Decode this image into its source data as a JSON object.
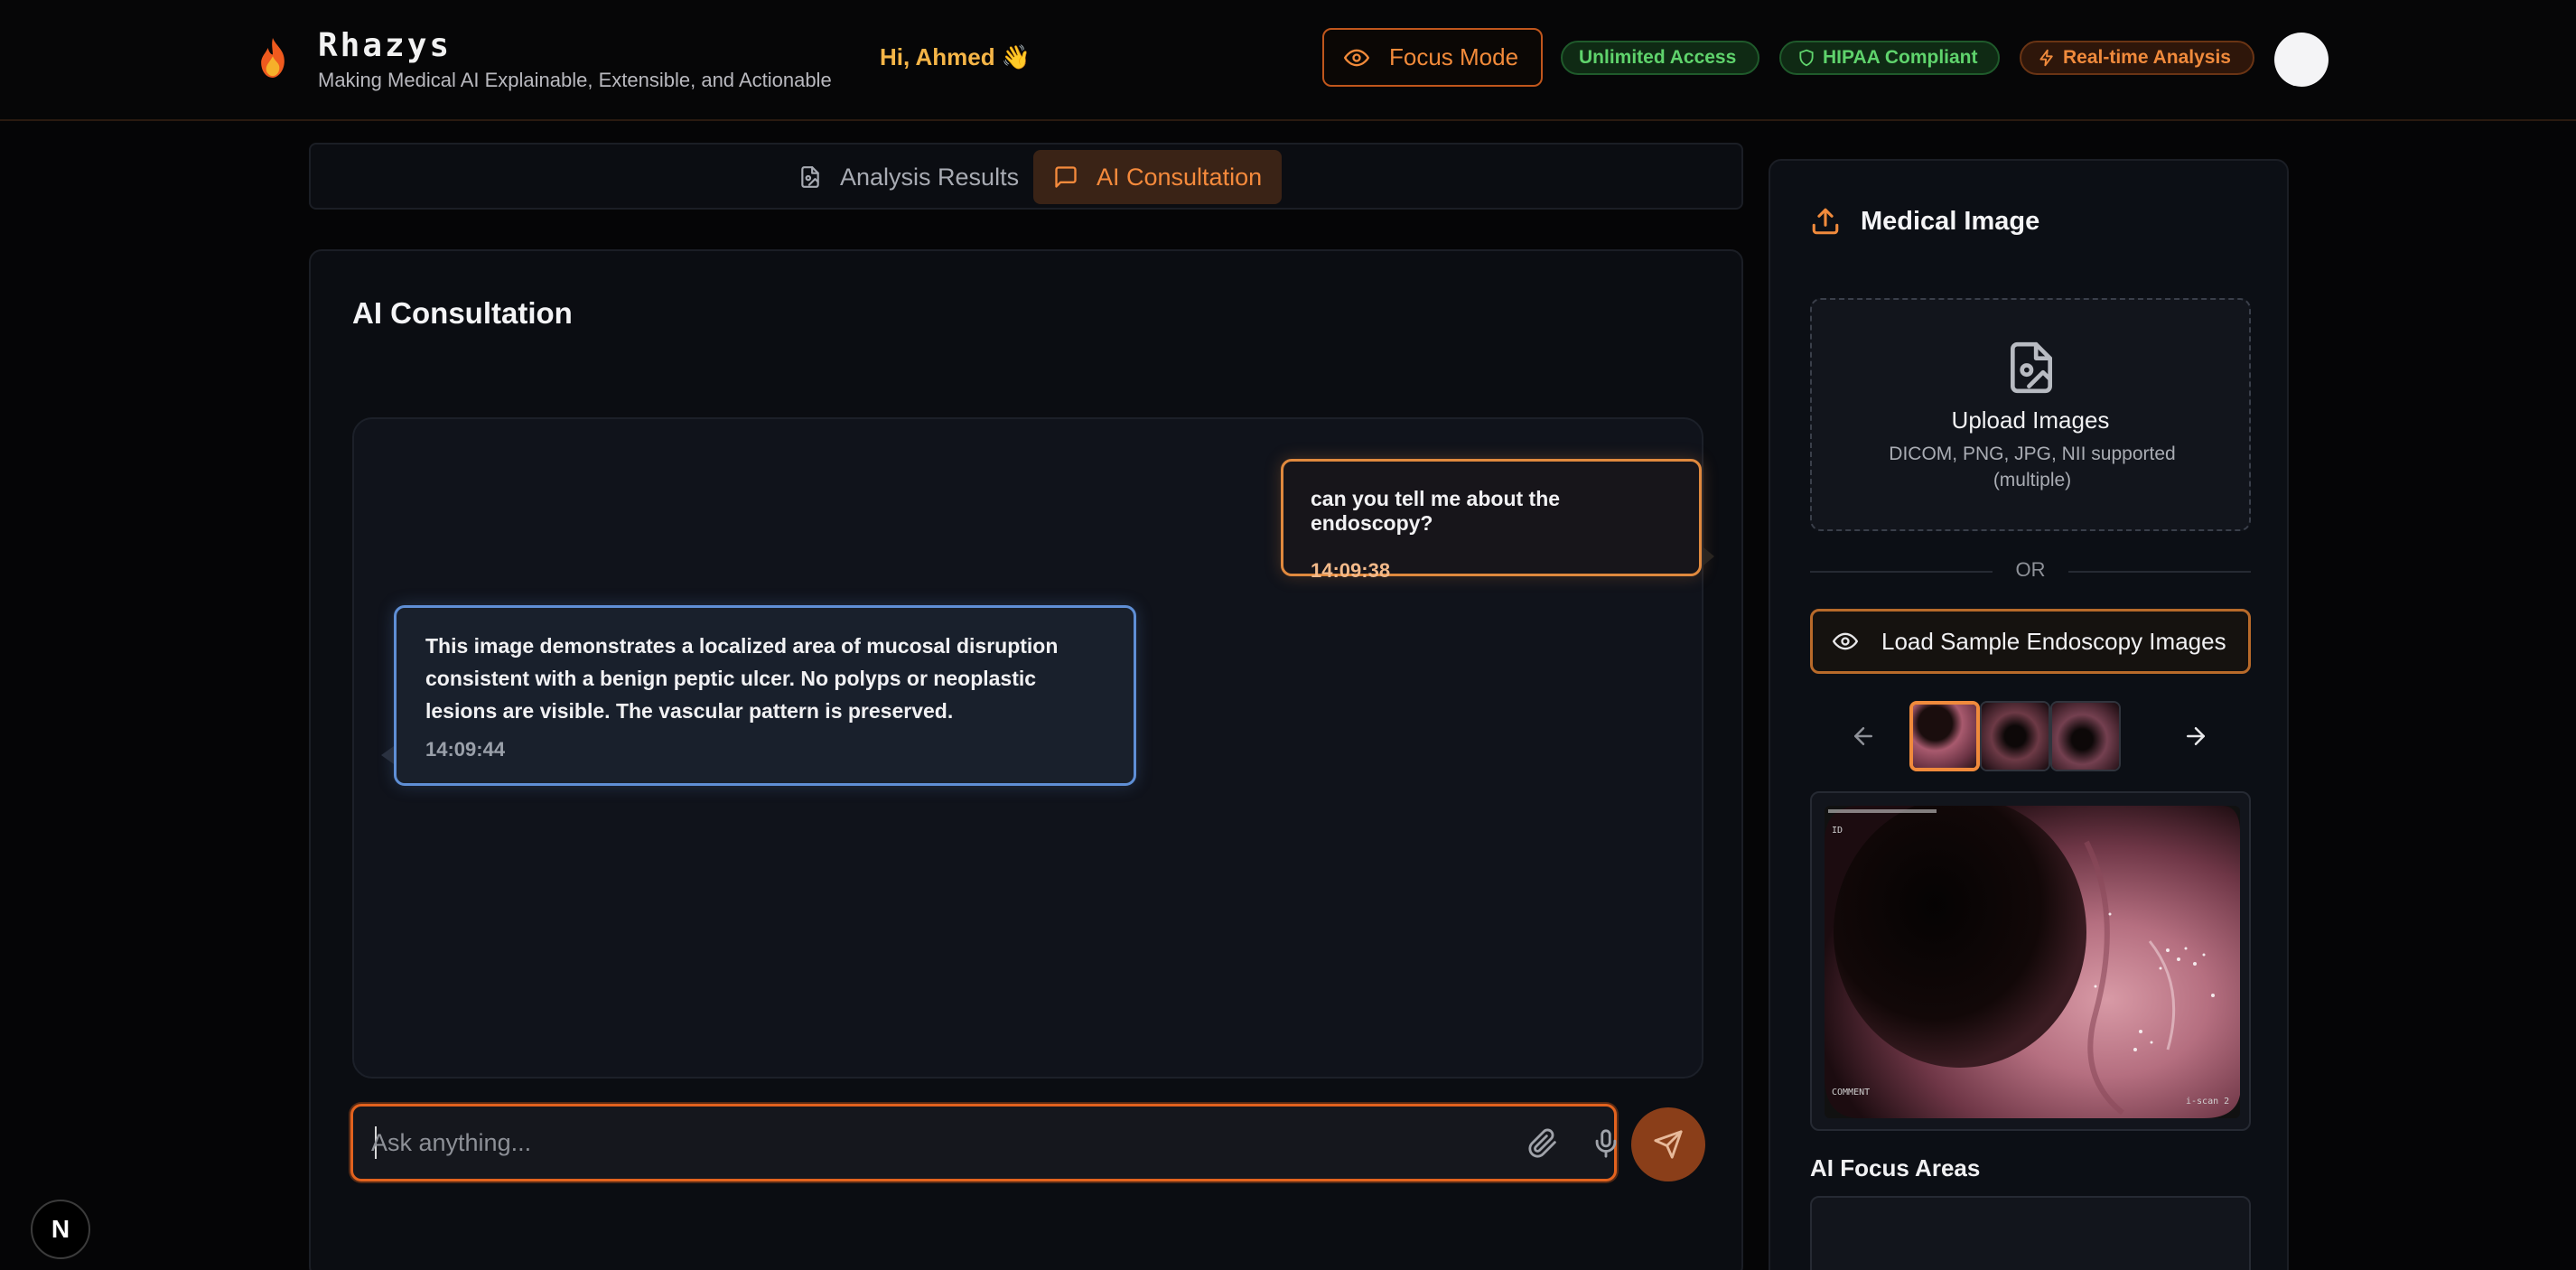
{
  "header": {
    "brand": "Rhazys",
    "tagline": "Making Medical AI Explainable, Extensible, and Actionable",
    "greeting": "Hi, Ahmed 👋",
    "focus_mode_label": "Focus Mode",
    "badges": [
      {
        "label": "Unlimited Access"
      },
      {
        "label": "HIPAA Compliant"
      },
      {
        "label": "Real-time Analysis"
      }
    ]
  },
  "tabs": {
    "analysis_label": "Analysis Results",
    "ai_label": "AI Consultation",
    "active": "AI Consultation"
  },
  "consultation": {
    "title": "AI Consultation",
    "messages": [
      {
        "role": "user",
        "text": "can you tell me about the endoscopy?",
        "time": "14:09:38"
      },
      {
        "role": "assistant",
        "text": "This image demonstrates a localized area of mucosal disruption consistent with a benign peptic ulcer. No polyps or neoplastic lesions are visible. The vascular pattern is preserved.",
        "time": "14:09:44"
      }
    ],
    "input_placeholder": "Ask anything..."
  },
  "side_panel": {
    "title": "Medical Image",
    "upload_title": "Upload Images",
    "upload_sub": "DICOM, PNG, JPG, NII supported (multiple)",
    "or_label": "OR",
    "sample_button_label": "Load Sample Endoscopy Images",
    "thumbnails_count": 3,
    "selected_thumbnail": 1,
    "focus_areas_title": "AI Focus Areas"
  },
  "colors": {
    "accent": "#f08a3c",
    "green": "#5fd36c",
    "user_bubble_border": "#e0893e",
    "ai_bubble_border": "#5f8fd6"
  },
  "footer": {
    "n_badge": "N"
  }
}
